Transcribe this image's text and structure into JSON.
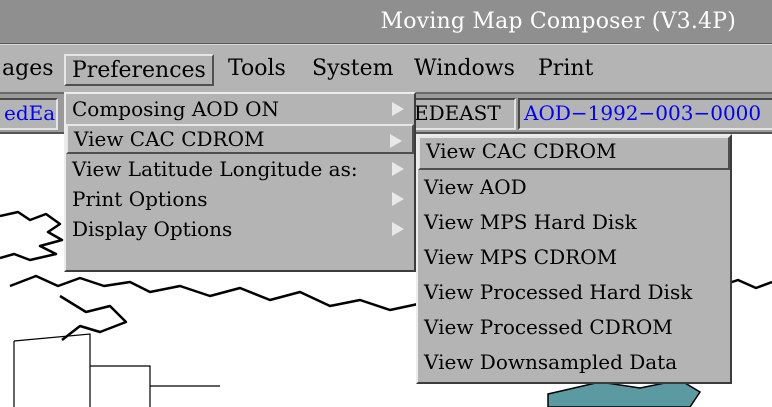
{
  "window": {
    "title": "Moving Map Composer  (V3.4P)"
  },
  "menubar": {
    "items": [
      {
        "label": "ages",
        "underline": ""
      },
      {
        "label": "Preferences",
        "underline": "P"
      },
      {
        "label": "Tools",
        "underline": "T"
      },
      {
        "label": "System",
        "underline": "S"
      },
      {
        "label": "Windows",
        "underline": "W"
      },
      {
        "label": "Print",
        "underline": "r"
      }
    ],
    "active": "Preferences"
  },
  "fields": {
    "left": "edEas",
    "middle": "EDEAST",
    "right": "AOD−1992−003−0000"
  },
  "preferences_menu": {
    "items": [
      {
        "label": "Composing AOD ON",
        "has_submenu": true
      },
      {
        "label": "View CAC CDROM",
        "has_submenu": true,
        "highlighted": true
      },
      {
        "label": "View Latitude Longitude as:",
        "has_submenu": true
      },
      {
        "label": "Print Options",
        "has_submenu": true
      },
      {
        "label": "Display Options",
        "has_submenu": true
      }
    ]
  },
  "view_submenu": {
    "items": [
      {
        "label": "View CAC CDROM",
        "highlighted": true
      },
      {
        "label": "View AOD"
      },
      {
        "label": "View MPS Hard Disk"
      },
      {
        "label": "View MPS CDROM"
      },
      {
        "label": "View Processed Hard Disk"
      },
      {
        "label": "View Processed CDROM"
      },
      {
        "label": "View Downsampled Data"
      }
    ]
  },
  "colors": {
    "titlebar": "#8f8f8f",
    "menu_bg": "#b4b4b4",
    "field_text": "#0000ff",
    "water": "#5a9aa0",
    "coastline": "#000000"
  }
}
